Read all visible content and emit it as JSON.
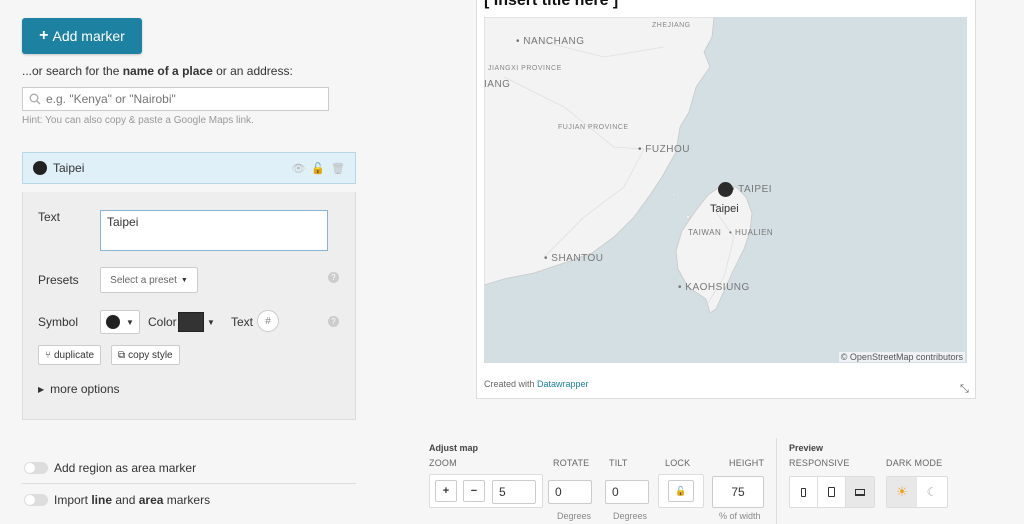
{
  "left": {
    "add_marker_label": "Add marker",
    "search_prefix": "...or search for the ",
    "search_bold1": "name of a place",
    "search_mid": " or an address:",
    "search_placeholder": "e.g. \"Kenya\" or \"Nairobi\"",
    "hint": "Hint: You can also copy & paste a Google Maps link.",
    "marker_name": "Taipei",
    "text_label": "Text",
    "text_value": "Taipei",
    "presets_label": "Presets",
    "preset_select": "Select a preset",
    "symbol_label": "Symbol",
    "color_label": "Color",
    "text_field_label": "Text",
    "text_hash": "#",
    "duplicate_label": "duplicate",
    "copy_style_label": "copy style",
    "more_options_label": "more options",
    "add_region_label": "Add region as area marker",
    "import_prefix": "Import ",
    "import_bold1": "line",
    "import_mid": " and ",
    "import_bold2": "area",
    "import_suffix": " markers"
  },
  "map": {
    "title": "[ Insert title here ]",
    "labels": {
      "nanchang": "NANCHANG",
      "zhejiang": "ZHEJIANG",
      "jiangxi": "JIANGXI PROVINCE",
      "jiang": "IANG",
      "fujian": "FUJIAN PROVINCE",
      "fuzhou": "FUZHOU",
      "taipei_city": "TAIPEI",
      "taipei_marker": "Taipei",
      "taiwan": "TAIWAN",
      "hualien": "HUALIEN",
      "shantou": "SHANTOU",
      "kaohsiung": "KAOHSIUNG"
    },
    "attribution": "© OpenStreetMap contributors",
    "created_prefix": "Created with ",
    "created_link": "Datawrapper"
  },
  "adjust": {
    "section_title": "Adjust map",
    "zoom_label": "ZOOM",
    "rotate_label": "ROTATE",
    "tilt_label": "TILT",
    "lock_label": "LOCK",
    "height_label": "HEIGHT",
    "zoom_value": "5",
    "rotate_value": "0",
    "tilt_value": "0",
    "height_value": "75",
    "rotate_unit": "Degrees",
    "tilt_unit": "Degrees",
    "height_unit": "% of width"
  },
  "preview": {
    "section_title": "Preview",
    "responsive_label": "RESPONSIVE",
    "dark_mode_label": "DARK MODE"
  }
}
